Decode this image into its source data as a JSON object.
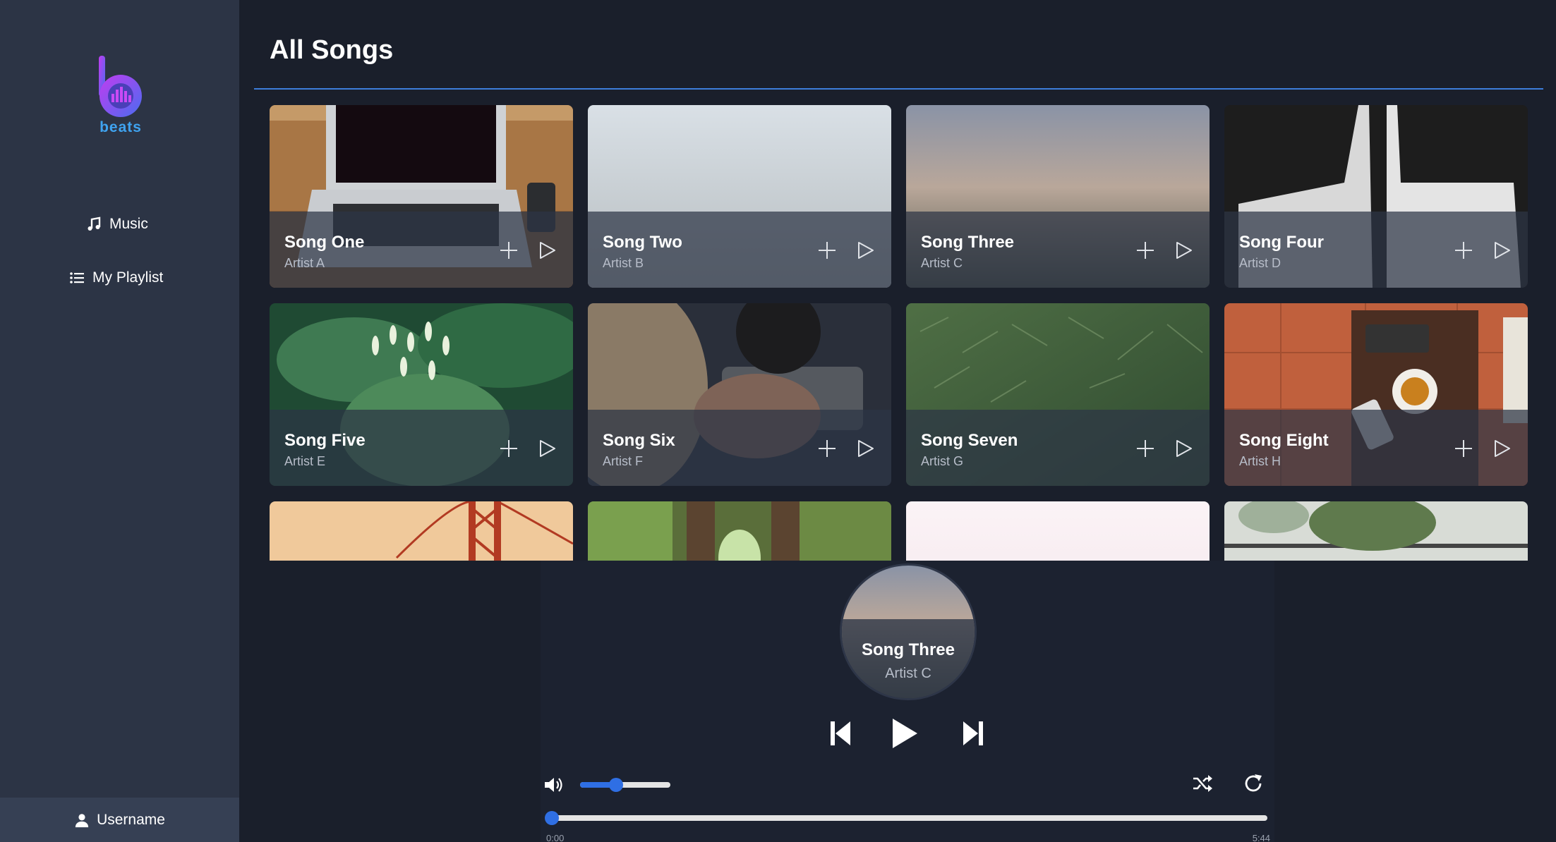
{
  "app": {
    "logo_text": "beats",
    "brand_color": "#3fa3f0",
    "accent_color": "#2f6fe4"
  },
  "sidebar": {
    "items": [
      {
        "label": "Music",
        "icon": "music-note-icon"
      },
      {
        "label": "My Playlist",
        "icon": "list-icon"
      }
    ],
    "user": {
      "label": "Username",
      "icon": "user-icon"
    }
  },
  "main": {
    "title": "All Songs",
    "songs": [
      {
        "title": "Song One",
        "artist": "Artist A",
        "art": "laptop-on-desk"
      },
      {
        "title": "Song Two",
        "artist": "Artist B",
        "art": "foggy-sky"
      },
      {
        "title": "Song Three",
        "artist": "Artist C",
        "art": "cloudy-hills"
      },
      {
        "title": "Song Four",
        "artist": "Artist D",
        "art": "white-sculpture"
      },
      {
        "title": "Song Five",
        "artist": "Artist E",
        "art": "green-plant"
      },
      {
        "title": "Song Six",
        "artist": "Artist F",
        "art": "camera-in-hand"
      },
      {
        "title": "Song Seven",
        "artist": "Artist G",
        "art": "grass"
      },
      {
        "title": "Song Eight",
        "artist": "Artist H",
        "art": "coffee-table"
      },
      {
        "title": "",
        "artist": "",
        "art": "golden-gate-bridge"
      },
      {
        "title": "",
        "artist": "",
        "art": "forest-path"
      },
      {
        "title": "",
        "artist": "",
        "art": "pink-sky"
      },
      {
        "title": "",
        "artist": "",
        "art": "plant-window"
      }
    ]
  },
  "player": {
    "now_playing": {
      "title": "Song Three",
      "artist": "Artist C"
    },
    "volume": 0.4,
    "progress": 0,
    "time_elapsed": "0:00",
    "time_total": "5:44"
  }
}
